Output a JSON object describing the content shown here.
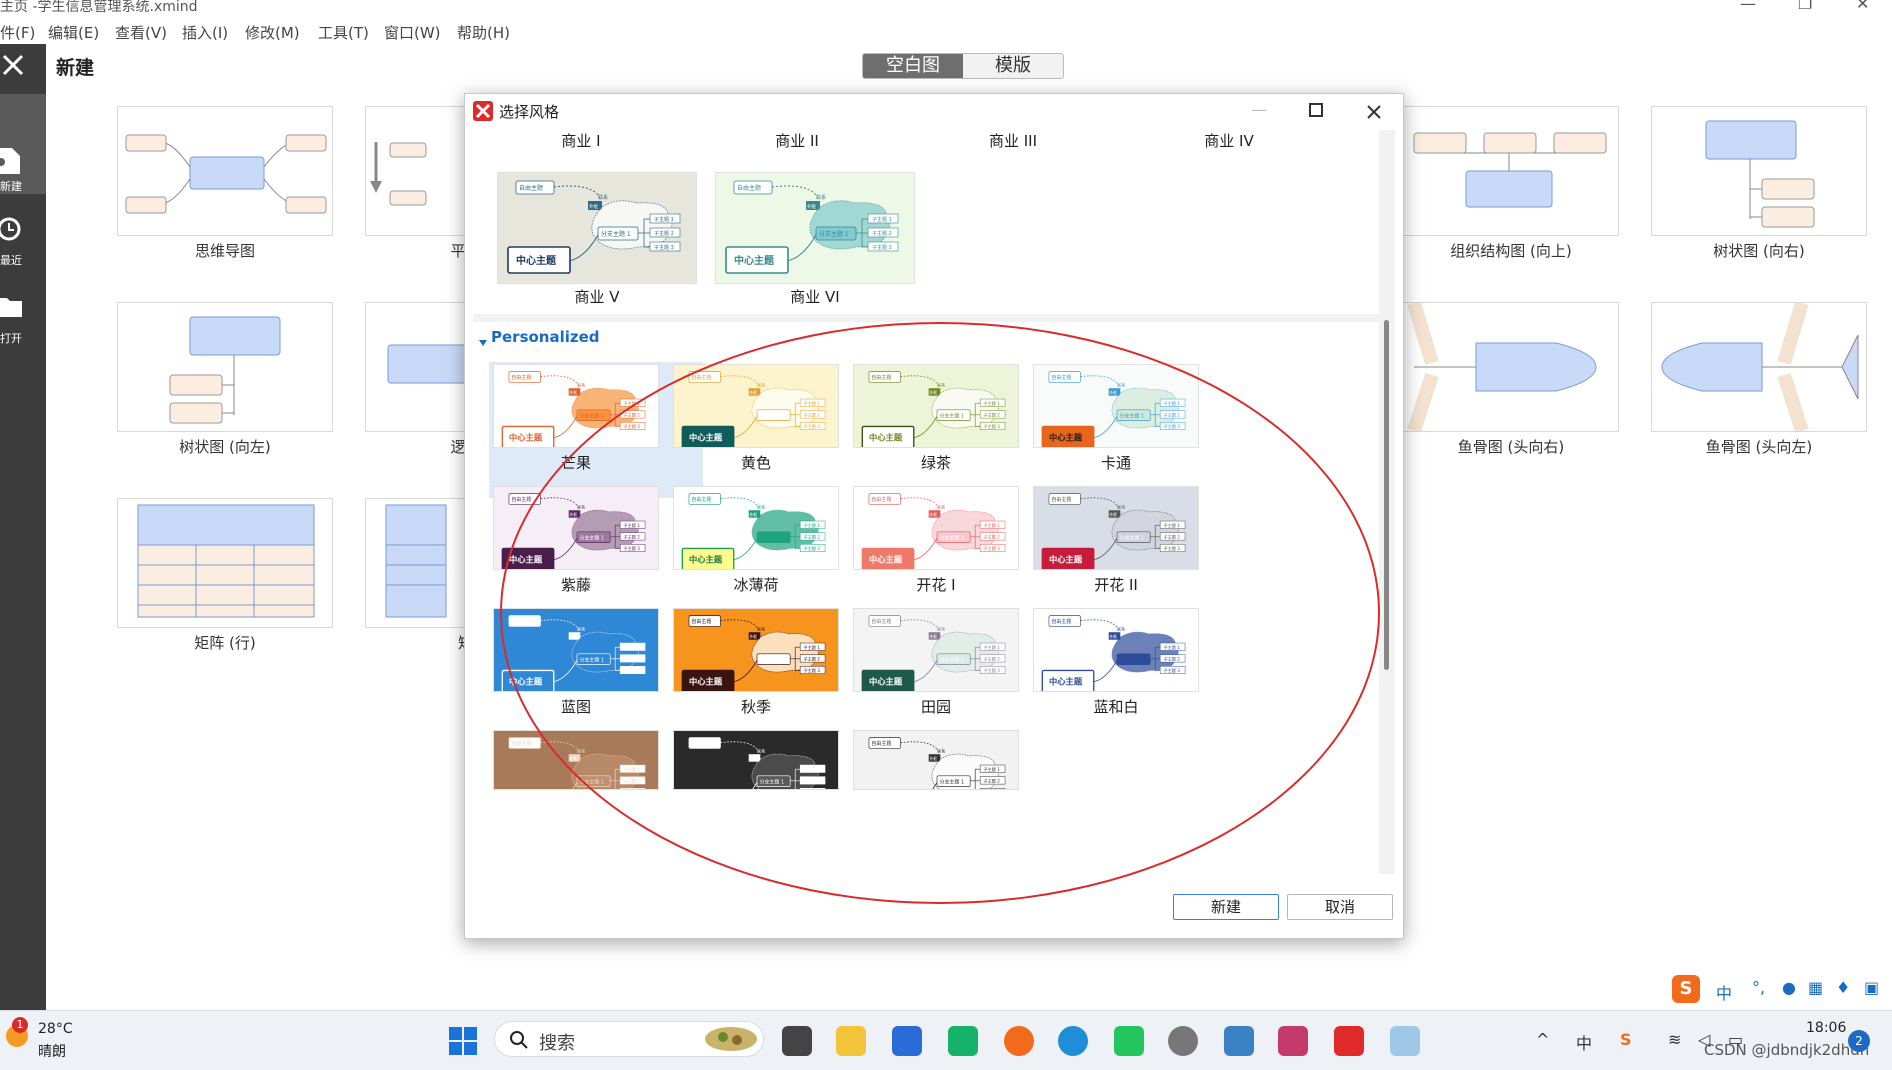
{
  "window": {
    "title": "主页 -学生信息管理系统.xmind",
    "menu": [
      "件(F)",
      "编辑(E)",
      "查看(V)",
      "插入(I)",
      "修改(M)",
      "工具(T)",
      "窗口(W)",
      "帮助(H)"
    ]
  },
  "sidebar": {
    "items": [
      {
        "label": "新建",
        "icon": "new-file-icon"
      },
      {
        "label": "最近",
        "icon": "clock-icon"
      },
      {
        "label": "打开",
        "icon": "folder-icon"
      }
    ]
  },
  "header": {
    "title": "新建",
    "tabs": [
      "空白图",
      "模版"
    ],
    "active_tab": "空白图"
  },
  "templates": [
    {
      "label": "思维导图"
    },
    {
      "label": "平衡图"
    },
    {
      "label": "组织结构图 (向上)"
    },
    {
      "label": "树状图 (向右)"
    },
    {
      "label": "树状图 (向左)"
    },
    {
      "label": "逻辑图"
    },
    {
      "label": "鱼骨图 (头向右)"
    },
    {
      "label": "鱼骨图 (头向左)"
    },
    {
      "label": "矩阵 (行)"
    },
    {
      "label": "矩阵"
    }
  ],
  "dialog": {
    "title": "选择风格",
    "top_names": [
      "商业 I",
      "商业 II",
      "商业 III",
      "商业 IV"
    ],
    "business_styles": [
      {
        "name": "商业 V",
        "bg": "#e6e6dc",
        "center_bg": "#ffffff",
        "center_fg": "#1e3a5f",
        "center_border": "#1e3a5f",
        "sub_bg": "#ffffff",
        "accent": "#2f6b86"
      },
      {
        "name": "商业 VI",
        "bg": "#edf8e6",
        "center_bg": "#ffffff",
        "center_fg": "#3a8a8f",
        "center_border": "#3a8a8f",
        "sub_bg": "#7fcbcf",
        "accent": "#3a8a8f"
      }
    ],
    "section_title": "Personalized",
    "texts": {
      "free": "自由主题",
      "relation": "联系",
      "outside": "外框",
      "center": "中心主题",
      "branch": "分支主题 1",
      "sub1": "子主题 1",
      "sub2": "子主题 2",
      "sub3": "子主题 3"
    },
    "styles": [
      {
        "name": "芒果",
        "bg": "#ffffff",
        "center_bg": "#ffffff",
        "center_fg": "#e0612b",
        "center_border": "#e0612b",
        "sub_bg": "#f7933b",
        "accent": "#e0612b",
        "selected": true
      },
      {
        "name": "黄色",
        "bg": "#fdf3cc",
        "center_bg": "#0f5c5a",
        "center_fg": "#ffffff",
        "center_border": "#0f5c5a",
        "sub_bg": "#ffffff",
        "accent": "#e0a12b"
      },
      {
        "name": "绿茶",
        "bg": "#eef4d8",
        "center_bg": "#ffffff",
        "center_fg": "#6d8a1e",
        "center_border": "#3d4a0e",
        "sub_bg": "#ffffff",
        "accent": "#6d8a1e"
      },
      {
        "name": "卡通",
        "bg": "#f9fbfa",
        "center_bg": "#e8651e",
        "center_fg": "#222222",
        "center_border": "#e8651e",
        "sub_bg": "#cfe9d6",
        "accent": "#3a9bd9"
      },
      {
        "name": "紫藤",
        "bg": "#f6eef6",
        "center_bg": "#4a1e4a",
        "center_fg": "#ffffff",
        "center_border": "#4a1e4a",
        "sub_bg": "#9a7a9a",
        "accent": "#5e2b5e"
      },
      {
        "name": "冰薄荷",
        "bg": "#ffffff",
        "center_bg": "#fdfd8e",
        "center_fg": "#1d7a4a",
        "center_border": "#1d9a5a",
        "sub_bg": "#1ea37e",
        "accent": "#1ea37e"
      },
      {
        "name": "开花 I",
        "bg": "#ffffff",
        "center_bg": "#f07a6a",
        "center_fg": "#ffffff",
        "center_border": "#f07a6a",
        "sub_bg": "#f7c8d0",
        "accent": "#e85a5a"
      },
      {
        "name": "开花 II",
        "bg": "#d9dde8",
        "center_bg": "#c41c3a",
        "center_fg": "#ffffff",
        "center_border": "#c41c3a",
        "sub_bg": "#d0d3dc",
        "accent": "#555555"
      },
      {
        "name": "蓝图",
        "bg": "#2f88d6",
        "center_bg": "#2f88d6",
        "center_fg": "#ffffff",
        "center_border": "#ffffff",
        "sub_bg": "#2f88d6",
        "accent": "#ffffff"
      },
      {
        "name": "秋季",
        "bg": "#f7941e",
        "center_bg": "#3a1410",
        "center_fg": "#ffffff",
        "center_border": "#3a1410",
        "sub_bg": "#ffffff",
        "accent": "#3a1410"
      },
      {
        "name": "田园",
        "bg": "#f4f4f4",
        "center_bg": "#1e5a4a",
        "center_fg": "#ffffff",
        "center_border": "#1e5a4a",
        "sub_bg": "#d9ece4",
        "accent": "#8a7a9a"
      },
      {
        "name": "蓝和白",
        "bg": "#ffffff",
        "center_bg": "#ffffff",
        "center_fg": "#2d4d9a",
        "center_border": "#2d4d9a",
        "sub_bg": "#2d4d9a",
        "accent": "#2d4d9a"
      },
      {
        "name": "",
        "bg": "#a87a5a",
        "center_bg": "#a87a5a",
        "center_fg": "#f2d6c0",
        "center_border": "#a87a5a",
        "sub_bg": "#c09070",
        "accent": "#f2d6c0"
      },
      {
        "name": "",
        "bg": "#2a2a2a",
        "center_bg": "#2a2a2a",
        "center_fg": "#ffffff",
        "center_border": "#ffffff",
        "sub_bg": "#5a5a5a",
        "accent": "#ffffff"
      },
      {
        "name": "",
        "bg": "#f2f2f2",
        "center_bg": "#ffffff",
        "center_fg": "#333333",
        "center_border": "#333333",
        "sub_bg": "#ffffff",
        "accent": "#333333"
      }
    ],
    "buttons": {
      "ok": "新建",
      "cancel": "取消"
    }
  },
  "taskbar": {
    "weather_temp": "28°C",
    "weather_text": "晴朗",
    "weather_badge": "1",
    "search_placeholder": "搜索",
    "ime_label": "中",
    "time": "18:06",
    "notif_count": "2",
    "watermark": "CSDN @jdbndjk2dhdh"
  }
}
